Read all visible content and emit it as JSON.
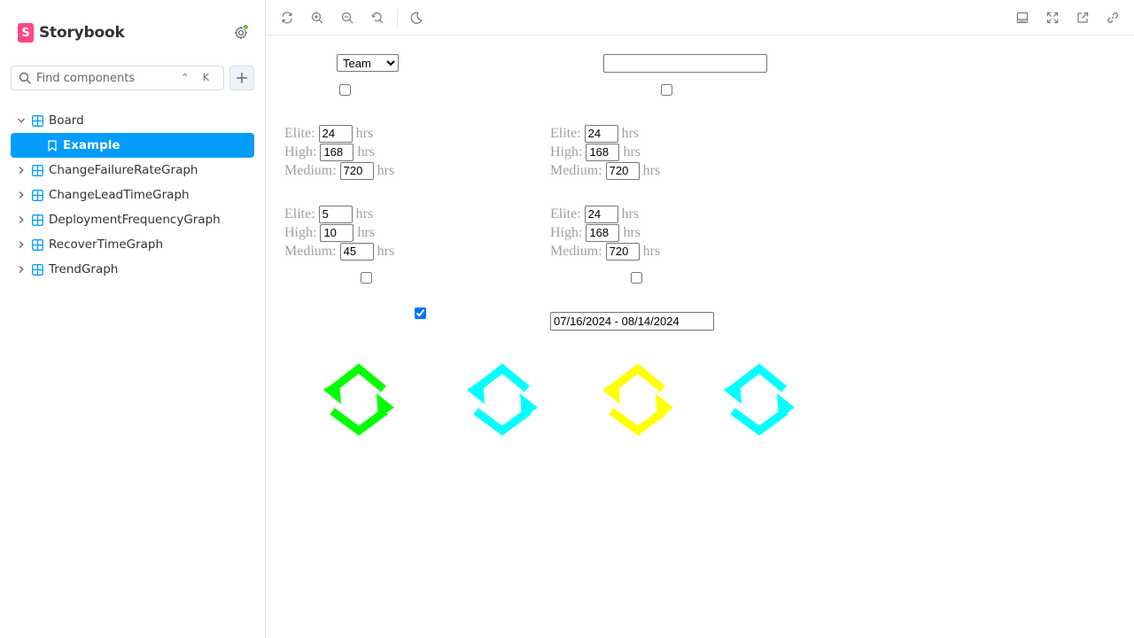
{
  "app": {
    "name": "Storybook"
  },
  "search": {
    "placeholder": "Find components",
    "shortcut": "⌃ K"
  },
  "sidebar": {
    "items": [
      {
        "label": "Board",
        "expanded": true
      },
      {
        "label": "Example",
        "selected": true
      },
      {
        "label": "ChangeFailureRateGraph"
      },
      {
        "label": "ChangeLeadTimeGraph"
      },
      {
        "label": "DeploymentFrequencyGraph"
      },
      {
        "label": "RecoverTimeGraph"
      },
      {
        "label": "TrendGraph"
      }
    ]
  },
  "toolbar": {
    "left_icons": [
      "reload-icon",
      "zoom-in-icon",
      "zoom-out-icon",
      "zoom-reset-icon",
      "moon-icon"
    ],
    "right_icons": [
      "panel-icon",
      "fullscreen-icon",
      "new-tab-icon",
      "link-icon"
    ]
  },
  "canvas": {
    "team_select": {
      "value": "Team",
      "options": [
        "Team"
      ]
    },
    "text_input": {
      "value": ""
    },
    "checkbox_top_left": false,
    "checkbox_top_right": false,
    "threshold_groups": [
      {
        "elite_label": "Elite:",
        "elite": "24",
        "high_label": "High:",
        "high": "168",
        "medium_label": "Medium:",
        "medium": "720",
        "unit": "hrs"
      },
      {
        "elite_label": "Elite:",
        "elite": "24",
        "high_label": "High:",
        "high": "168",
        "medium_label": "Medium:",
        "medium": "720",
        "unit": "hrs"
      },
      {
        "elite_label": "Elite:",
        "elite": "5",
        "high_label": "High:",
        "high": "10",
        "medium_label": "Medium:",
        "medium": "45",
        "unit": "hrs"
      },
      {
        "elite_label": "Elite:",
        "elite": "24",
        "high_label": "High:",
        "high": "168",
        "medium_label": "Medium:",
        "medium": "720",
        "unit": "hrs"
      }
    ],
    "checkbox_mid_left": false,
    "checkbox_mid_right": false,
    "checkbox_checked": true,
    "date_range": "07/16/2024 - 08/14/2024",
    "cycle_icons": [
      {
        "color": "#00ff00"
      },
      {
        "color": "#00ffff"
      },
      {
        "color": "#ffff00"
      },
      {
        "color": "#00ffff"
      }
    ]
  }
}
